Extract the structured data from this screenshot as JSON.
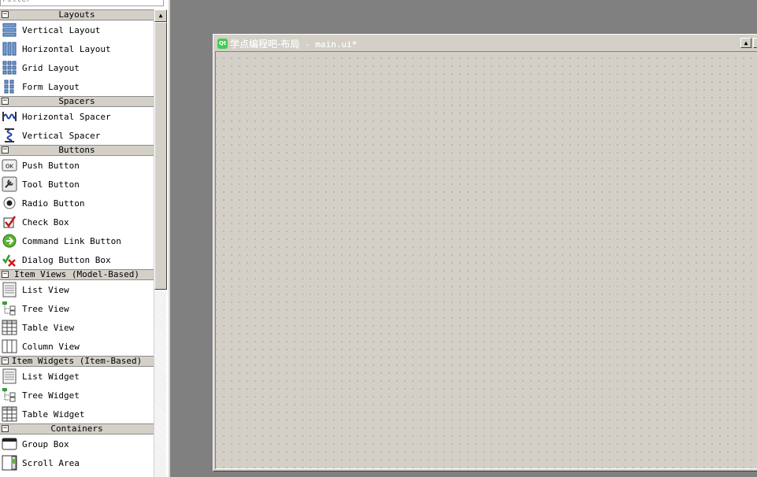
{
  "filter": {
    "placeholder": "Filter"
  },
  "categories": [
    {
      "label": "Layouts",
      "items": [
        {
          "label": "Vertical Layout",
          "icon": "vertical-layout-icon"
        },
        {
          "label": "Horizontal Layout",
          "icon": "horizontal-layout-icon"
        },
        {
          "label": "Grid Layout",
          "icon": "grid-layout-icon"
        },
        {
          "label": "Form Layout",
          "icon": "form-layout-icon"
        }
      ]
    },
    {
      "label": "Spacers",
      "items": [
        {
          "label": "Horizontal Spacer",
          "icon": "horizontal-spacer-icon"
        },
        {
          "label": "Vertical Spacer",
          "icon": "vertical-spacer-icon"
        }
      ]
    },
    {
      "label": "Buttons",
      "items": [
        {
          "label": "Push Button",
          "icon": "push-button-icon"
        },
        {
          "label": "Tool Button",
          "icon": "tool-button-icon"
        },
        {
          "label": "Radio Button",
          "icon": "radio-button-icon"
        },
        {
          "label": "Check Box",
          "icon": "check-box-icon"
        },
        {
          "label": "Command Link Button",
          "icon": "command-link-icon"
        },
        {
          "label": "Dialog Button Box",
          "icon": "dialog-button-box-icon"
        }
      ]
    },
    {
      "label": "Item Views (Model-Based)",
      "items": [
        {
          "label": "List View",
          "icon": "list-view-icon"
        },
        {
          "label": "Tree View",
          "icon": "tree-view-icon"
        },
        {
          "label": "Table View",
          "icon": "table-view-icon"
        },
        {
          "label": "Column View",
          "icon": "column-view-icon"
        }
      ]
    },
    {
      "label": "Item Widgets (Item-Based)",
      "items": [
        {
          "label": "List Widget",
          "icon": "list-widget-icon"
        },
        {
          "label": "Tree Widget",
          "icon": "tree-widget-icon"
        },
        {
          "label": "Table Widget",
          "icon": "table-widget-icon"
        }
      ]
    },
    {
      "label": "Containers",
      "items": [
        {
          "label": "Group Box",
          "icon": "group-box-icon"
        },
        {
          "label": "Scroll Area",
          "icon": "scroll-area-icon"
        }
      ]
    }
  ],
  "form": {
    "title_cn": "学点编程吧-布局",
    "title_sep": " - ",
    "title_file": "main.ui*",
    "logo_text": "Qt"
  },
  "colors": {
    "desktop": "#808080",
    "panel": "#d4d0c8",
    "qt_green": "#41cd52"
  }
}
